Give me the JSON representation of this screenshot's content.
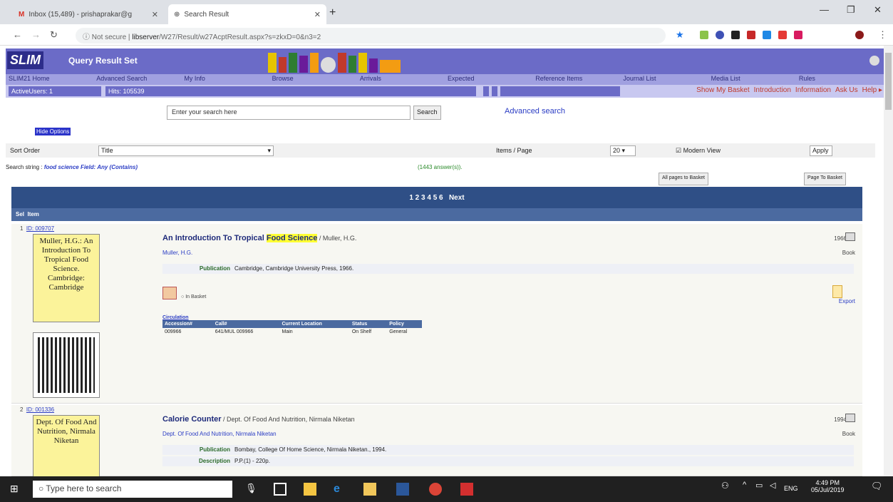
{
  "browser": {
    "tab1": "Inbox (15,489) - prishaprakar@g",
    "tab2": "Search Result",
    "url_prefix": "Not secure",
    "url_host": "libserver",
    "url_rest": "/W27/Result/w27AcptResult.aspx?s=zkxD=0&n3=2"
  },
  "banner": {
    "logo": "SLIM",
    "title": "Query Result Set"
  },
  "menu": [
    "SLIM21 Home",
    "Advanced Search",
    "My Info",
    "Browse",
    "Arrivals",
    "Expected",
    "Reference Items",
    "Journal List",
    "Media List",
    "Rules"
  ],
  "status": {
    "active_users": "ActiveUsers: 1",
    "hits": "Hits: 105539"
  },
  "toplinks": [
    "Show My Basket",
    "Introduction",
    "Information",
    "Ask Us",
    "Help ▸"
  ],
  "search": {
    "placeholder": "Enter your search here",
    "button": "Search",
    "advanced": "Advanced search",
    "hide_options": "Hide Options"
  },
  "sort": {
    "label": "Sort Order",
    "value": "Title",
    "items_label": "Items / Page",
    "items_value": "20",
    "modern_view": "Modern View",
    "apply": "Apply"
  },
  "search_string": {
    "label": "Search string : ",
    "value": "food science Field: Any (Contains)",
    "answers": "(1443 answer(s))."
  },
  "buttons": {
    "all_pages": "All pages to Basket",
    "page_to_basket": "Page To Basket"
  },
  "pager": {
    "pages": "1 2 3 4 5 6",
    "next": "Next"
  },
  "columns": {
    "sel": "Sel",
    "item": "Item"
  },
  "records": [
    {
      "num": "1",
      "id": "ID: 009707",
      "card": "Muller, H.G.: An Introduction To Tropical Food Science. Cambridge: Cambridge",
      "title_pre": "An Introduction To Tropical ",
      "title_hl": "Food Science",
      "author_inline": " / Muller, H.G.",
      "author": "Muller, H.G.",
      "pub_k": "Publication",
      "pub_v": "Cambridge, Cambridge University Press, 1966.",
      "year": "1966",
      "type": "Book",
      "in_basket": "In Basket",
      "export": "Export",
      "circ_title": "Circulation",
      "circ_headers": [
        "Accession#",
        "Call#",
        "Current Location",
        "Status",
        "Policy"
      ],
      "circ_row": [
        "009966",
        "641/MUL 009966",
        "Main",
        "On Shelf",
        "General"
      ]
    },
    {
      "num": "2",
      "id": "ID: 001336",
      "card": "Dept. Of Food And Nutrition, Nirmala Niketan",
      "title_pre": "Calorie Counter",
      "author_inline": " / Dept. Of Food And Nutrition, Nirmala Niketan",
      "author": "Dept. Of Food And Nutrition, Nirmala Niketan",
      "pub_k": "Publication",
      "pub_v": "Bombay, College Of Home Science, Nirmala Niketan., 1994.",
      "desc_k": "Description",
      "desc_v": "P.P.(1) - 220p.",
      "year": "1994",
      "type": "Book"
    }
  ],
  "taskbar": {
    "search": "Type here to search",
    "time": "4:49 PM",
    "date": "05/Jul/2019",
    "lang": "ENG"
  }
}
